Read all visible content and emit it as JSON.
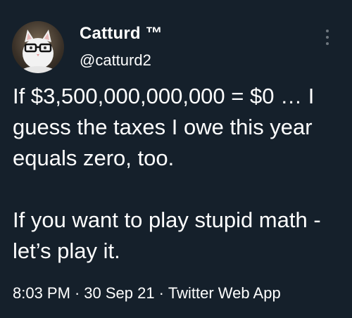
{
  "user": {
    "display_name": "Catturd ™",
    "handle": "@catturd2",
    "avatar_icon": "cat-with-glasses-avatar"
  },
  "tweet": {
    "paragraph_1": "If $3,500,000,000,000 = $0 … I guess the taxes I owe this year equals zero, too.",
    "paragraph_2": "If you want to play stupid math - let’s play it."
  },
  "meta": {
    "time": "8:03 PM",
    "separator": "·",
    "date": "30 Sep 21",
    "source": "Twitter Web App"
  },
  "colors": {
    "background": "#15202b",
    "text": "#ffffff",
    "more_icon": "#6e767d"
  },
  "icons": {
    "more": "more-options-icon"
  }
}
